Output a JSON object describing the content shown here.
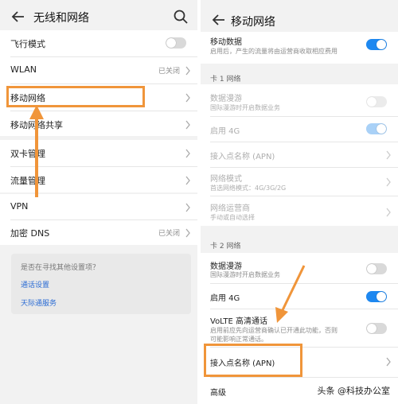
{
  "left": {
    "title": "无线和网络",
    "rows": {
      "airplane": "飞行模式",
      "wlan": "WLAN",
      "wlan_status": "已关闭",
      "mobile_network": "移动网络",
      "tethering": "移动网络共享",
      "dual_sim": "双卡管理",
      "data_usage": "流量管理",
      "vpn": "VPN",
      "encrypted_dns": "加密 DNS",
      "dns_status": "已关闭"
    },
    "suggest": {
      "question": "是否在寻找其他设置项？",
      "link1": "通话设置",
      "link2": "天际通服务"
    }
  },
  "right": {
    "title": "移动网络",
    "mobile_data": "移动数据",
    "mobile_data_desc": "启用后，产生的流量将由运营商收取相应费用",
    "card1_label": "卡 1 网络",
    "card1": {
      "roaming": "数据漫游",
      "roaming_desc": "国际漫游时开启数据业务",
      "enable4g": "启用 4G",
      "apn": "接入点名称 (APN)",
      "network_mode": "网络模式",
      "network_mode_desc": "首选网络模式：4G/3G/2G",
      "operator": "网络运营商",
      "operator_desc": "手动或自动选择"
    },
    "card2_label": "卡 2 网络",
    "card2": {
      "roaming": "数据漫游",
      "roaming_desc": "国际漫游时开启数据业务",
      "enable4g": "启用 4G",
      "volte": "VoLTE 高清通话",
      "volte_desc_1": "启用前应先向运营商确认已开通此功能，否则",
      "volte_desc_2": "可能影响正常通话。",
      "apn": "接入点名称 (APN)"
    },
    "advanced": "高级"
  },
  "watermark": "头条 @科技办公室",
  "colors": {
    "accent": "#1e88f0",
    "highlight": "#f0953a",
    "link": "#2b6cd4"
  }
}
